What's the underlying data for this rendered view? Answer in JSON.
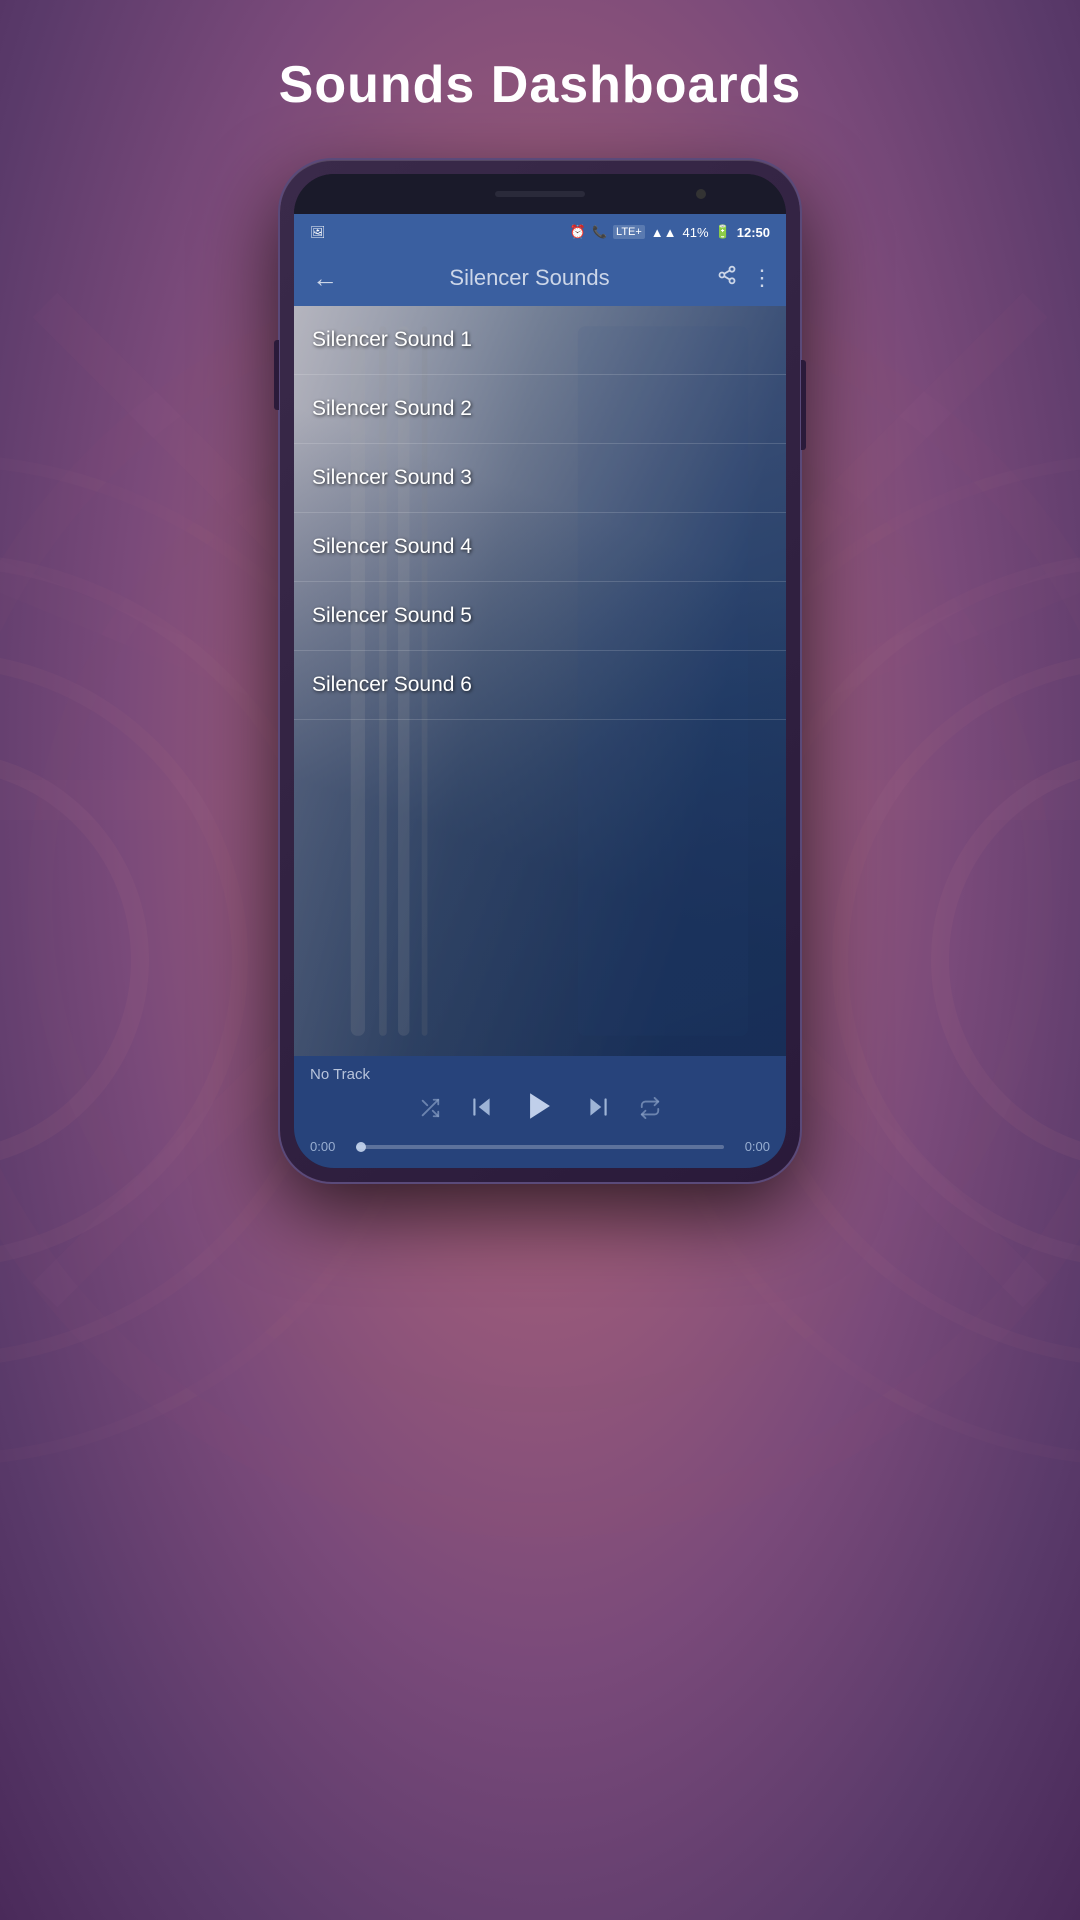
{
  "page": {
    "title": "Sounds Dashboards",
    "background_color": "#7a5a8a"
  },
  "status_bar": {
    "battery": "41%",
    "time": "12:50",
    "network": "LTE+",
    "signal": "4G"
  },
  "app_header": {
    "title": "Silencer Sounds",
    "back_label": "←",
    "share_icon": "share",
    "menu_icon": "⋮"
  },
  "sound_list": {
    "items": [
      {
        "id": 1,
        "label": "Silencer Sound 1"
      },
      {
        "id": 2,
        "label": "Silencer Sound 2"
      },
      {
        "id": 3,
        "label": "Silencer Sound 3"
      },
      {
        "id": 4,
        "label": "Silencer Sound 4"
      },
      {
        "id": 5,
        "label": "Silencer Sound 5"
      },
      {
        "id": 6,
        "label": "Silencer Sound 6"
      }
    ]
  },
  "player": {
    "no_track_label": "No Track",
    "time_start": "0:00",
    "time_end": "0:00",
    "progress_percent": 0
  }
}
